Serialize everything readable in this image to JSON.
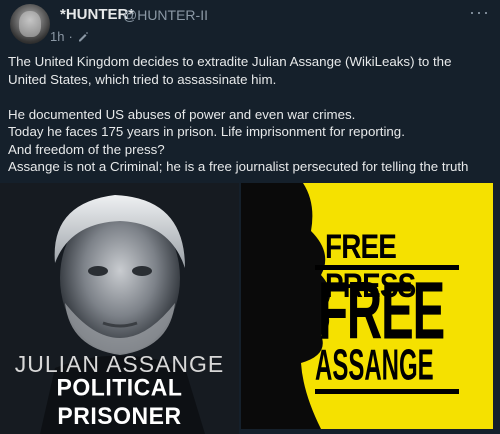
{
  "header": {
    "display_name": "*HUNTER*",
    "handle": "@HUNTER-II",
    "time": "1h",
    "more_label": "···"
  },
  "tweet": {
    "paragraph1": "The United Kingdom decides to extradite Julian Assange (WikiLeaks) to the United States, which tried to assassinate him.",
    "lines": [
      "He documented US abuses of power and even war crimes.",
      "Today he faces 175 years in prison. Life imprisonment for reporting.",
      "And freedom of the press?",
      "Assange is not a Criminal; he is a free journalist persecuted for telling the truth"
    ]
  },
  "media": {
    "left": {
      "caption_top": "JULIAN ASSANGE",
      "caption_bottom": "POLITICAL PRISONER"
    },
    "right": {
      "line1": "FREE PRESS",
      "line2": "FREE",
      "line3": "ASSANGE",
      "background": "#f5e100"
    }
  },
  "colors": {
    "background": "#15202b",
    "text": "#e7e9ea",
    "muted": "#8b98a5"
  }
}
